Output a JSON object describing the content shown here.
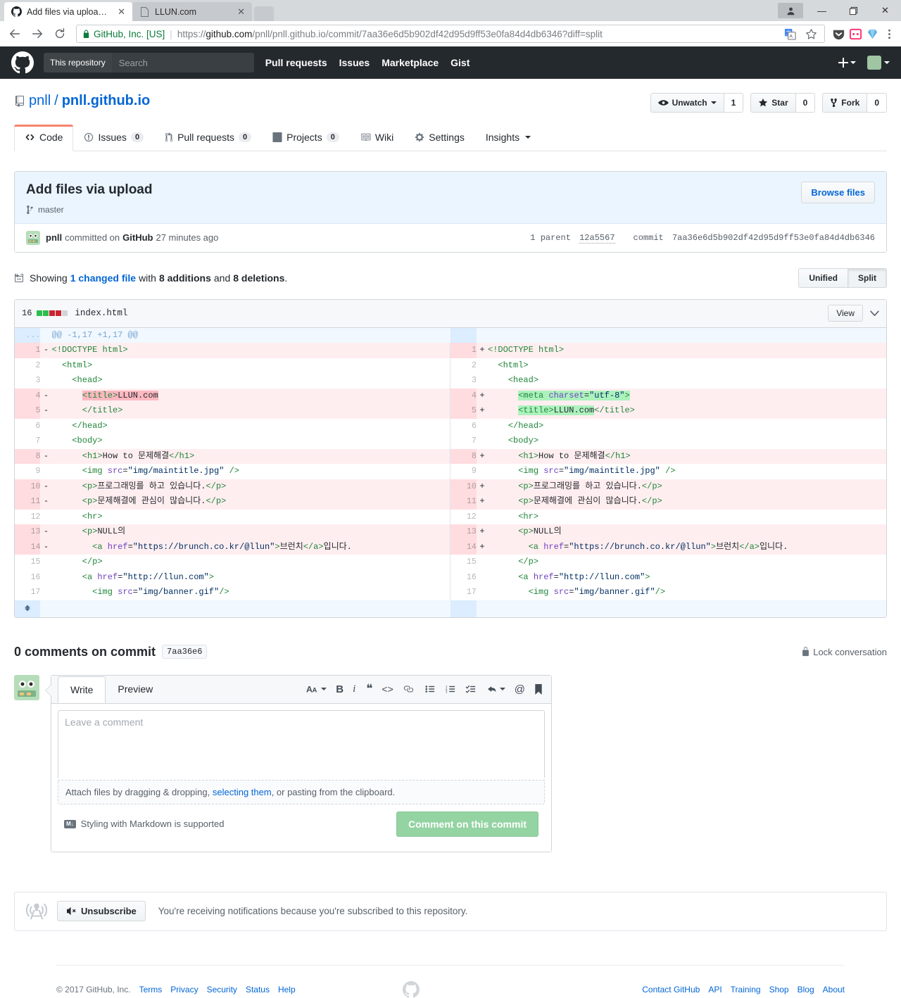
{
  "browser": {
    "tabs": [
      {
        "title": "Add files via upload · pr",
        "favicon": "github-icon",
        "active": true
      },
      {
        "title": "LLUN.com",
        "favicon": "page-icon",
        "active": false
      }
    ],
    "security_label": "GitHub, Inc. [US]",
    "url_scheme": "https://",
    "url_host": "github.com",
    "url_path": "/pnll/pnll.github.io/commit/7aa36e6d5b902df42d95d9ff53e0fa84d4db6346?diff=split",
    "window_controls": [
      "minimize",
      "maximize",
      "close"
    ]
  },
  "gh_header": {
    "scope": "This repository",
    "search_placeholder": "Search",
    "nav": [
      "Pull requests",
      "Issues",
      "Marketplace",
      "Gist"
    ]
  },
  "repo": {
    "owner": "pnll",
    "slash": "/",
    "name": "pnll.github.io",
    "actions": [
      {
        "label": "Unwatch",
        "count": "1",
        "icon": "eye-icon",
        "caret": true
      },
      {
        "label": "Star",
        "count": "0",
        "icon": "star-icon",
        "caret": false
      },
      {
        "label": "Fork",
        "count": "0",
        "icon": "fork-icon",
        "caret": false
      }
    ],
    "tabs": [
      {
        "label": "Code",
        "icon": "code-icon",
        "count": null,
        "selected": true
      },
      {
        "label": "Issues",
        "icon": "issue-icon",
        "count": "0",
        "selected": false
      },
      {
        "label": "Pull requests",
        "icon": "pull-request-icon",
        "count": "0",
        "selected": false
      },
      {
        "label": "Projects",
        "icon": "project-icon",
        "count": "0",
        "selected": false
      },
      {
        "label": "Wiki",
        "icon": "book-icon",
        "count": null,
        "selected": false
      },
      {
        "label": "Settings",
        "icon": "gear-icon",
        "count": null,
        "selected": false
      },
      {
        "label": "Insights",
        "icon": null,
        "count": null,
        "selected": false,
        "caret": true
      }
    ]
  },
  "commit": {
    "title": "Add files via upload",
    "branch": "master",
    "browse_files": "Browse files",
    "author": "pnll",
    "meta_prefix": "committed on",
    "platform": "GitHub",
    "time": "27 minutes ago",
    "parent_label": "1 parent",
    "parent_sha": "12a5567",
    "commit_label": "commit",
    "commit_sha": "7aa36e6d5b902df42d95d9ff53e0fa84d4db6346"
  },
  "diffbar": {
    "showing": "Showing",
    "changed_file_link": "1 changed file",
    "with": "with",
    "additions": "8 additions",
    "and": "and",
    "deletions": "8 deletions",
    "period": ".",
    "unified": "Unified",
    "split": "Split",
    "selected_view": "Split"
  },
  "file": {
    "stat_number": "16",
    "stat_blocks": [
      "add",
      "add",
      "del",
      "del",
      "none"
    ],
    "name": "index.html",
    "view_button": "View",
    "chevron": "chevron-down-icon"
  },
  "diff": {
    "hunk_header": "@@ -1,17 +1,17 @@",
    "hunk_dots": "...",
    "rows": [
      {
        "type": "del",
        "ln": "1",
        "rn": "1",
        "lsign": "-",
        "rsign": "+",
        "lcode": "<!DOCTYPE html>",
        "rcode": "<!DOCTYPE html>",
        "lhl": false,
        "rhl": false
      },
      {
        "type": "ctx",
        "ln": "2",
        "rn": "2",
        "lsign": "",
        "rsign": "",
        "lcode": "  <html>",
        "rcode": "  <html>"
      },
      {
        "type": "ctx",
        "ln": "3",
        "rn": "3",
        "lsign": "",
        "rsign": "",
        "lcode": "    <head>",
        "rcode": "    <head>"
      },
      {
        "type": "del",
        "ln": "4",
        "rn": "4",
        "lsign": "-",
        "rsign": "+",
        "lcode": "      <title>LLUN.com",
        "rcode": "      <meta charset=\"utf-8\">",
        "lhl": true,
        "rhl": true
      },
      {
        "type": "del",
        "ln": "5",
        "rn": "5",
        "lsign": "-",
        "rsign": "+",
        "lcode": "      </title>",
        "rcode": "      <title>LLUN.com</title>",
        "lhl": false,
        "rhl": true
      },
      {
        "type": "ctx",
        "ln": "6",
        "rn": "6",
        "lsign": "",
        "rsign": "",
        "lcode": "    </head>",
        "rcode": "    </head>"
      },
      {
        "type": "ctx",
        "ln": "7",
        "rn": "7",
        "lsign": "",
        "rsign": "",
        "lcode": "    <body>",
        "rcode": "    <body>"
      },
      {
        "type": "del",
        "ln": "8",
        "rn": "8",
        "lsign": "-",
        "rsign": "+",
        "lcode": "      <h1>How to 문제해결</h1>",
        "rcode": "      <h1>How to 문제해결</h1>"
      },
      {
        "type": "ctx",
        "ln": "9",
        "rn": "9",
        "lsign": "",
        "rsign": "",
        "lcode": "      <img src=\"img/maintitle.jpg\" />",
        "rcode": "      <img src=\"img/maintitle.jpg\" />"
      },
      {
        "type": "del",
        "ln": "10",
        "rn": "10",
        "lsign": "-",
        "rsign": "+",
        "lcode": "      <p>프로그래밍를 하고 있습니다.</p>",
        "rcode": "      <p>프로그래밍를 하고 있습니다.</p>"
      },
      {
        "type": "del",
        "ln": "11",
        "rn": "11",
        "lsign": "-",
        "rsign": "+",
        "lcode": "      <p>문제해결에 관심이 많습니다.</p>",
        "rcode": "      <p>문제해결에 관심이 많습니다.</p>"
      },
      {
        "type": "ctx",
        "ln": "12",
        "rn": "12",
        "lsign": "",
        "rsign": "",
        "lcode": "      <hr>",
        "rcode": "      <hr>"
      },
      {
        "type": "del",
        "ln": "13",
        "rn": "13",
        "lsign": "-",
        "rsign": "+",
        "lcode": "      <p>NULL의",
        "rcode": "      <p>NULL의"
      },
      {
        "type": "del",
        "ln": "14",
        "rn": "14",
        "lsign": "-",
        "rsign": "+",
        "lcode": "        <a href=\"https://brunch.co.kr/@llun\">브런치</a>입니다.",
        "rcode": "        <a href=\"https://brunch.co.kr/@llun\">브런치</a>입니다."
      },
      {
        "type": "ctx",
        "ln": "15",
        "rn": "15",
        "lsign": "",
        "rsign": "",
        "lcode": "      </p>",
        "rcode": "      </p>"
      },
      {
        "type": "ctx",
        "ln": "16",
        "rn": "16",
        "lsign": "",
        "rsign": "",
        "lcode": "      <a href=\"http://llun.com\">",
        "rcode": "      <a href=\"http://llun.com\">"
      },
      {
        "type": "ctx",
        "ln": "17",
        "rn": "17",
        "lsign": "",
        "rsign": "",
        "lcode": "        <img src=\"img/banner.gif\"/>",
        "rcode": "        <img src=\"img/banner.gif\"/>"
      }
    ],
    "expand_icon": "unfold-icon"
  },
  "comments": {
    "heading": "0 comments on commit",
    "sha_chip": "7aa36e6",
    "lock_conversation": "Lock conversation",
    "tab_write": "Write",
    "tab_preview": "Preview",
    "toolbar_icons": [
      "text-size-icon",
      "bold-icon",
      "italic-icon",
      "quote-icon",
      "code-icon",
      "link-icon",
      "unordered-list-icon",
      "ordered-list-icon",
      "task-list-icon",
      "reply-icon",
      "mention-icon",
      "saved-replies-icon"
    ],
    "textarea_placeholder": "Leave a comment",
    "attach_prefix": "Attach files by dragging & dropping, ",
    "attach_link": "selecting them",
    "attach_suffix": ", or pasting from the clipboard.",
    "markdown_note": "Styling with Markdown is supported",
    "markdown_badge": "M↓",
    "submit_label": "Comment on this commit"
  },
  "subscription": {
    "icon": "broadcast-icon",
    "button": "Unsubscribe",
    "mute_icon": "mute-icon",
    "text": "You're receiving notifications because you're subscribed to this repository."
  },
  "footer": {
    "copyright": "© 2017 GitHub, Inc.",
    "left_links": [
      "Terms",
      "Privacy",
      "Security",
      "Status",
      "Help"
    ],
    "right_links": [
      "Contact GitHub",
      "API",
      "Training",
      "Shop",
      "Blog",
      "About"
    ],
    "logo": "github-mark-icon"
  },
  "colors": {
    "accent": "#0366d6",
    "header_bg": "#24292e",
    "add_bg": "#e6ffed",
    "del_bg": "#ffeef0",
    "tab_active": "#f9826c"
  }
}
